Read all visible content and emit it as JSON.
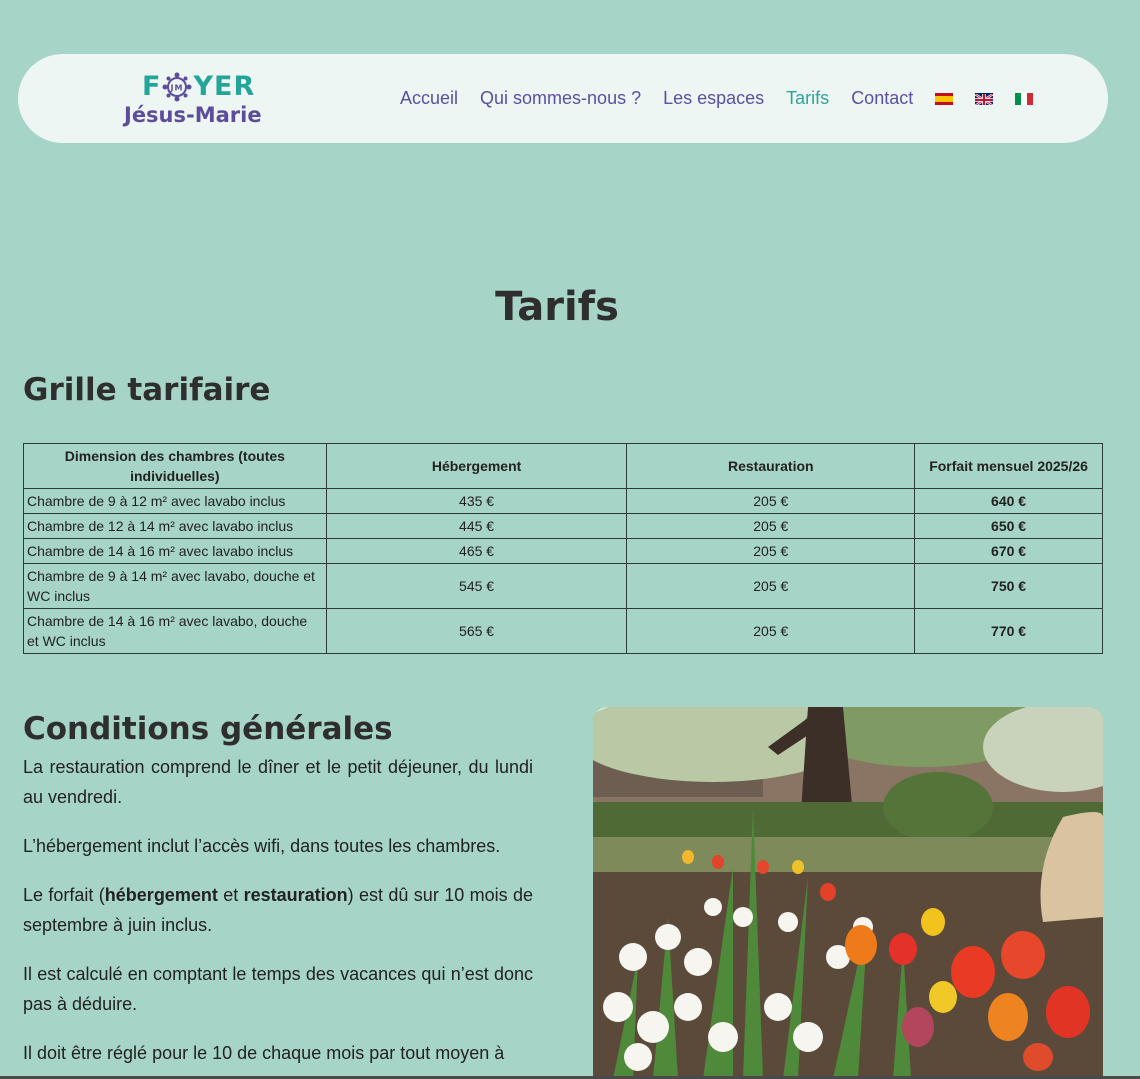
{
  "header": {
    "logo_top_left": "F",
    "logo_top_right": "YER",
    "logo_medal_text": "JM",
    "logo_bottom": "Jésus-Marie",
    "nav": [
      {
        "label": "Accueil"
      },
      {
        "label": "Qui sommes-nous ?"
      },
      {
        "label": "Les espaces"
      },
      {
        "label": "Tarifs",
        "active": true
      },
      {
        "label": "Contact"
      }
    ],
    "flags": [
      "flag-es-icon",
      "flag-uk-icon",
      "flag-it-icon"
    ]
  },
  "page_title": "Tarifs",
  "grille": {
    "heading": "Grille tarifaire",
    "columns": [
      "Dimension des chambres (toutes individuelles)",
      "Hébergement",
      "Restauration",
      "Forfait mensuel 2025/26"
    ],
    "rows": [
      [
        "Chambre de 9 à 12 m² avec lavabo inclus",
        "435 €",
        "205 €",
        "640 €"
      ],
      [
        "Chambre de 12 à 14 m² avec lavabo inclus",
        "445 €",
        "205 €",
        "650 €"
      ],
      [
        "Chambre de 14 à 16 m² avec lavabo inclus",
        "465 €",
        "205 €",
        "670 €"
      ],
      [
        "Chambre de 9 à 14 m² avec lavabo, douche et WC inclus",
        "545 €",
        "205 €",
        "750 €"
      ],
      [
        "Chambre de 14 à 16 m² avec lavabo, douche et WC inclus",
        "565 €",
        "205 €",
        "770 €"
      ]
    ]
  },
  "conditions": {
    "heading": "Conditions générales",
    "p1": "La restauration comprend le dîner et le petit déjeuner, du lundi au vendredi.",
    "p2": "L’hébergement inclut l’accès wifi, dans toutes les chambres.",
    "p3_a": "Le forfait (",
    "p3_b1": "hébergement",
    "p3_mid": " et ",
    "p3_b2": "restauration",
    "p3_c": ") est dû sur 10 mois de septembre à juin inclus.",
    "p4": "Il est calculé en comptant le temps des vacances qui n’est donc pas à déduire.",
    "p5": "Il doit être réglé pour le 10 de chaque mois par tout moyen à"
  },
  "colors": {
    "background": "#a6d4c6",
    "nav_text": "#5a4fa0",
    "nav_active": "#2aa596",
    "logo_teal": "#23a59a",
    "logo_purple": "#5c4d9b"
  }
}
